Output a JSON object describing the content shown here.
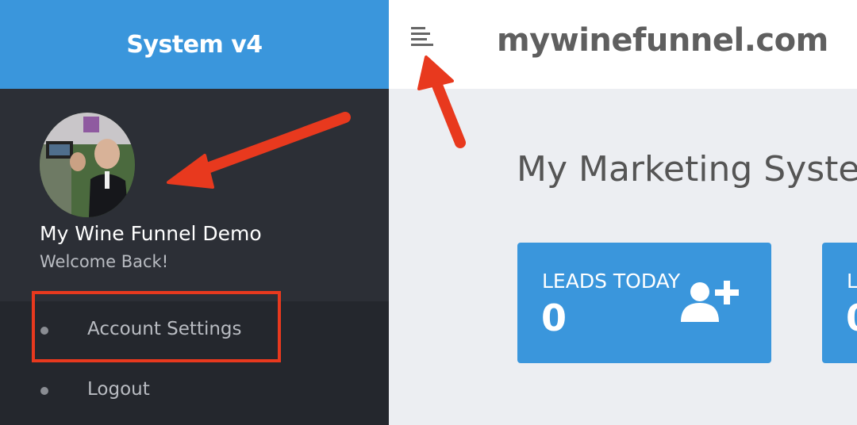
{
  "brand": {
    "title": "System v4"
  },
  "profile": {
    "name": "My Wine Funnel Demo",
    "subtitle": "Welcome Back!"
  },
  "menu": {
    "items": [
      {
        "label": "Account Settings"
      },
      {
        "label": "Logout"
      }
    ]
  },
  "header": {
    "site_title": "mywinefunnel.com",
    "menu_icon": "hamburger-icon"
  },
  "main": {
    "page_title": "My Marketing System",
    "cards": [
      {
        "title": "LEADS TODAY",
        "value": "0",
        "icon": "add-user-icon"
      },
      {
        "title": "L",
        "value": "0"
      }
    ]
  },
  "colors": {
    "brand_blue": "#3a96dc",
    "sidebar": "#2c2f36",
    "annotation_red": "#e8391e"
  }
}
